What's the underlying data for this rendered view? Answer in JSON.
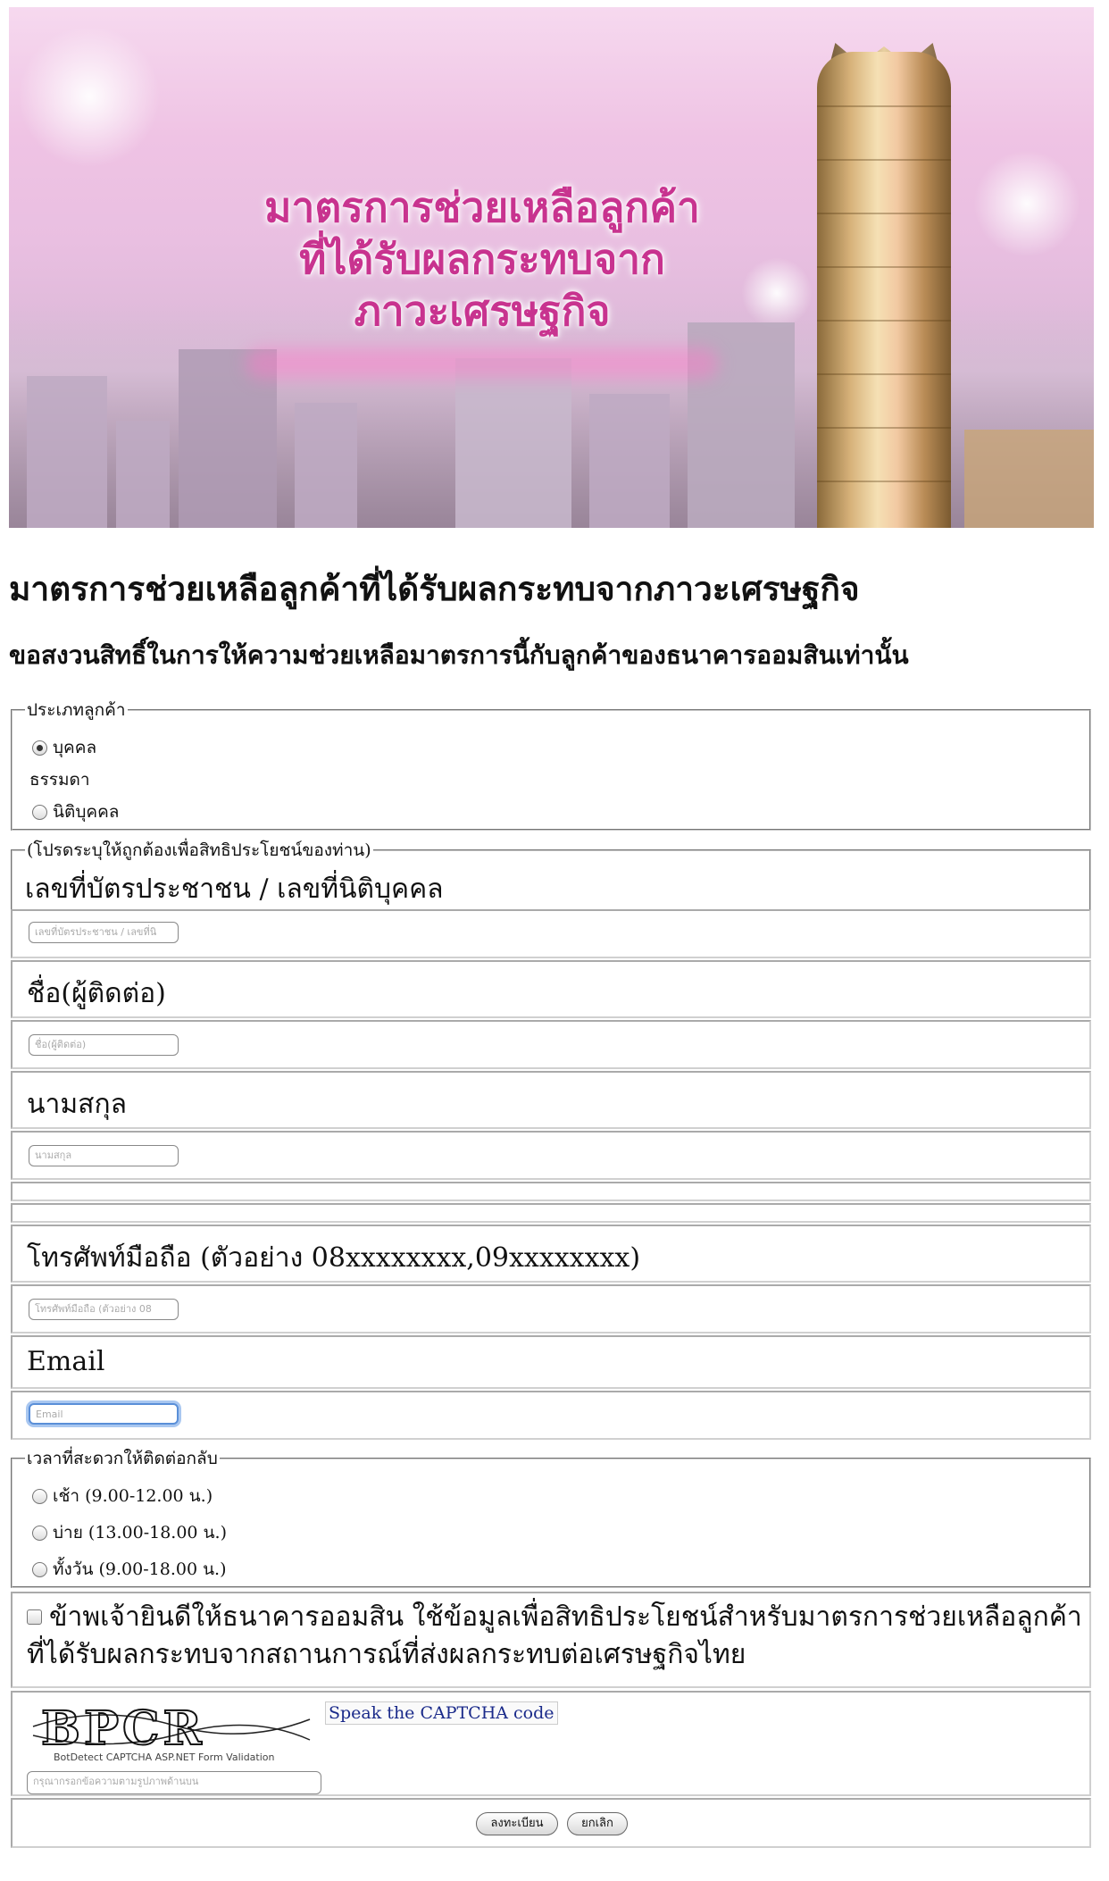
{
  "banner": {
    "line1": "มาตรการช่วยเหลือลูกค้า",
    "line2": "ที่ได้รับผลกระทบจาก",
    "line3": "ภาวะเศรษฐกิจ"
  },
  "page_title": "มาตรการช่วยเหลือลูกค้าที่ได้รับผลกระทบจากภาวะเศรษฐกิจ",
  "subtitle": "ขอสงวนสิทธิ์ในการให้ความช่วยเหลือมาตรการนี้กับลูกค้าของธนาคารออมสินเท่านั้น",
  "customer_type": {
    "legend": "ประเภทลูกค้า",
    "options": [
      {
        "label": "บุคคล",
        "label2": "ธรรมดา",
        "checked": true
      },
      {
        "label": "นิติบุคคล",
        "checked": false
      }
    ]
  },
  "form": {
    "legend": "(โปรดระบุให้ถูกต้องเพื่อสิทธิประโยชน์ของท่าน)",
    "id_label": "เลขที่บัตรประชาชน / เลขที่นิติบุคคล",
    "id_placeholder": "เลขที่บัตรประชาชน / เลขที่นิ",
    "name_label": "ชื่อ(ผู้ติดต่อ)",
    "name_placeholder": "ชื่อ(ผู้ติดต่อ)",
    "surname_label": "นามสกุล",
    "surname_placeholder": "นามสกุล",
    "phone_label": "โทรศัพท์มือถือ (ตัวอย่าง 08xxxxxxxx,09xxxxxxxx)",
    "phone_placeholder": "โทรศัพท์มือถือ (ตัวอย่าง 08",
    "email_label": "Email",
    "email_placeholder": "Email"
  },
  "contact_time": {
    "legend": "เวลาที่สะดวกให้ติดต่อกลับ",
    "options": [
      {
        "label": "เช้า (9.00-12.00 น.)",
        "checked": false
      },
      {
        "label": "บ่าย (13.00-18.00 น.)",
        "checked": false
      },
      {
        "label": "ทั้งวัน (9.00-18.00 น.)",
        "checked": false
      }
    ]
  },
  "consent": {
    "text": "ข้าพเจ้ายินดีให้ธนาคารออมสิน ใช้ข้อมูลเพื่อสิทธิประโยชน์สำหรับมาตรการช่วยเหลือลูกค้าที่ได้รับผลกระทบจากสถานการณ์ที่ส่งผลกระทบต่อเศรษฐกิจไทย",
    "checked": false
  },
  "captcha": {
    "code": "BPCR",
    "caption": "BotDetect CAPTCHA ASP.NET Form Validation",
    "speak_link": "Speak the CAPTCHA code",
    "input_placeholder": "กรุณากรอกข้อความตามรูปภาพด้านบน"
  },
  "buttons": {
    "submit": "ลงทะเบียน",
    "cancel": "ยกเลิก"
  },
  "colors": {
    "banner_text": "#c8338f",
    "link": "#1a2a8a",
    "focus_ring": "#a9c7f0"
  }
}
